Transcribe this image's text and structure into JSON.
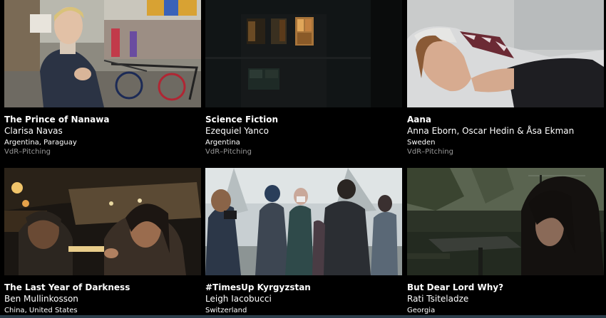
{
  "films": [
    {
      "title": "The Prince of Nanawa",
      "director": "Clarisa Navas",
      "country": "Argentina, Paraguay",
      "program": "VdR–Pitching",
      "thumb_icon": "boy-with-bicycles-street-image"
    },
    {
      "title": "Science Fiction",
      "director": "Ezequiel Yanco",
      "country": "Argentina",
      "program": "VdR–Pitching",
      "thumb_icon": "building-windows-at-night-image"
    },
    {
      "title": "Aana",
      "director": "Anna Eborn, Oscar Hedin & Åsa Ekman",
      "country": "Sweden",
      "program": "VdR–Pitching",
      "thumb_icon": "woman-sleeping-image"
    },
    {
      "title": "The Last Year of Darkness",
      "director": "Ben Mullinkosson",
      "country": "China, United States",
      "program": "",
      "thumb_icon": "two-people-in-car-night-image"
    },
    {
      "title": "#TimesUp Kyrgyzstan",
      "director": "Leigh Iacobucci",
      "country": "Switzerland",
      "program": "",
      "thumb_icon": "crowd-protest-street-image"
    },
    {
      "title": "But Dear Lord Why?",
      "director": "Rati Tsiteladze",
      "country": "Georgia",
      "program": "",
      "thumb_icon": "woman-in-dark-garden-image"
    }
  ]
}
